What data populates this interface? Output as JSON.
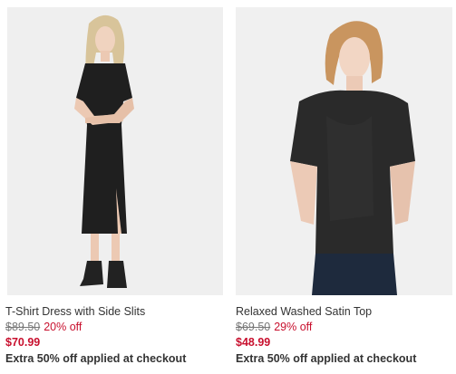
{
  "products": [
    {
      "name": "T-Shirt Dress with Side Slits",
      "original_price": "$89.50",
      "discount": "20% off",
      "sale_price": "$70.99",
      "promo": "Extra 50% off applied at checkout",
      "image": "model-in-black-tshirt-dress"
    },
    {
      "name": "Relaxed Washed Satin Top",
      "original_price": "$69.50",
      "discount": "29% off",
      "sale_price": "$48.99",
      "promo": "Extra 50% off applied at checkout",
      "image": "model-in-black-satin-top"
    }
  ],
  "colors": {
    "sale": "#c8102e",
    "text": "#333333",
    "muted": "#777777",
    "photo_bg": "#eeeeee"
  }
}
